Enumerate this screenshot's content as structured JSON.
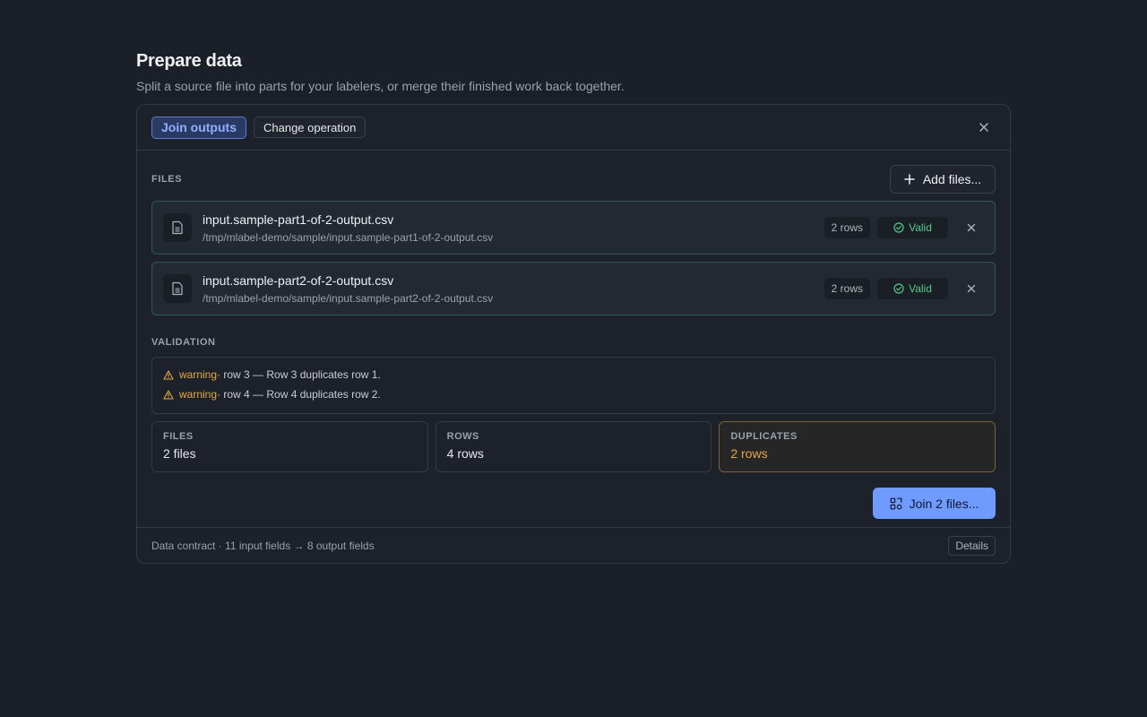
{
  "page": {
    "title": "Prepare data",
    "subtitle": "Split a source file into parts for your labelers, or merge their finished work back together."
  },
  "header": {
    "active_mode": "Join outputs",
    "change_operation": "Change operation",
    "close_icon": "close-icon"
  },
  "files_section": {
    "label": "FILES",
    "add_button": "Add files...",
    "items": [
      {
        "name": "input.sample-part1-of-2-output.csv",
        "path": "/tmp/mlabel-demo/sample/input.sample-part1-of-2-output.csv",
        "rows": "2 rows",
        "status": "Valid"
      },
      {
        "name": "input.sample-part2-of-2-output.csv",
        "path": "/tmp/mlabel-demo/sample/input.sample-part2-of-2-output.csv",
        "rows": "2 rows",
        "status": "Valid"
      }
    ]
  },
  "validation": {
    "label": "VALIDATION",
    "messages": [
      {
        "level": "warning",
        "text": " · row 3 — Row 3 duplicates row 1."
      },
      {
        "level": "warning",
        "text": " · row 4 — Row 4 duplicates row 2."
      }
    ]
  },
  "stats": {
    "files": {
      "label": "FILES",
      "value": "2 files"
    },
    "rows": {
      "label": "ROWS",
      "value": "4 rows"
    },
    "duplicates": {
      "label": "DUPLICATES",
      "value": "2 rows"
    }
  },
  "actions": {
    "join_button": "Join 2 files..."
  },
  "footer": {
    "contract": "Data contract · 11 input fields → 8 output fields",
    "details": "Details"
  },
  "colors": {
    "background": "#1b1f27",
    "accent": "#6f9bff",
    "valid": "#4fc98b",
    "warning": "#e3a84a"
  }
}
